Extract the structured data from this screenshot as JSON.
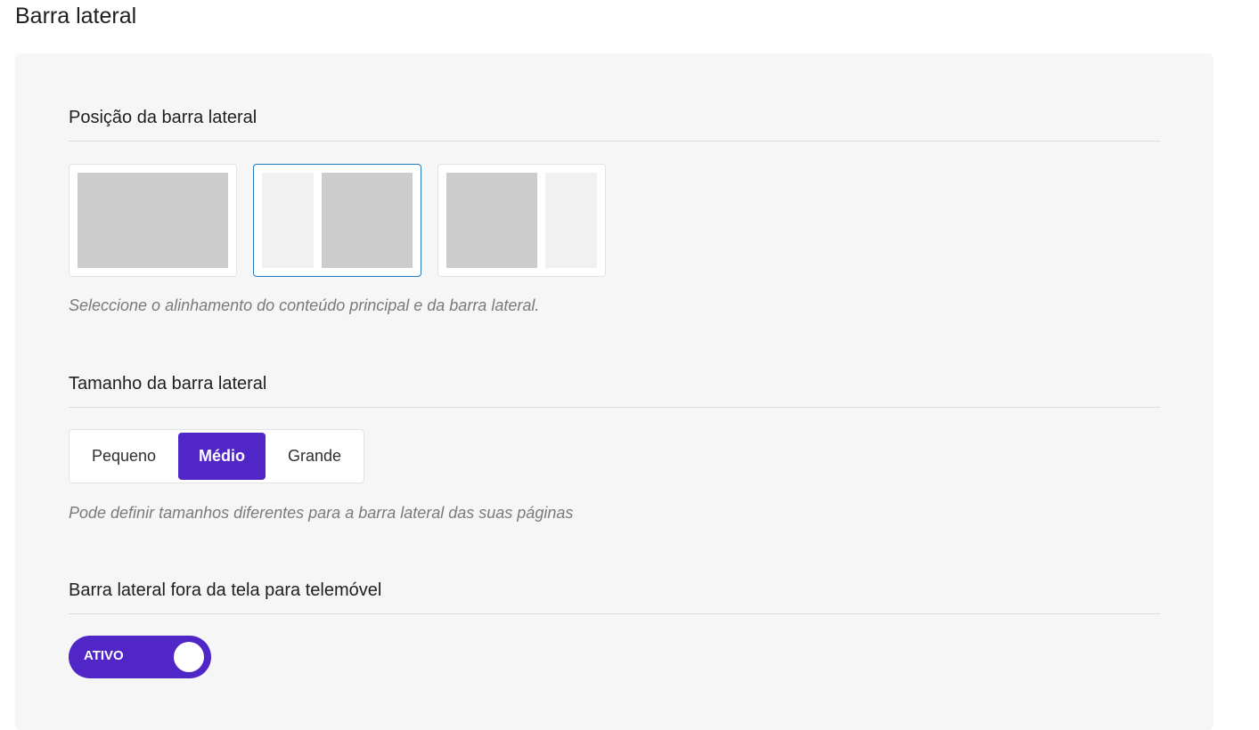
{
  "page": {
    "title": "Barra lateral"
  },
  "position": {
    "heading": "Posição da barra lateral",
    "help": "Seleccione o alinhamento do conteúdo principal e da barra lateral.",
    "options": [
      {
        "name": "full-width",
        "selected": false
      },
      {
        "name": "sidebar-left",
        "selected": true
      },
      {
        "name": "sidebar-right",
        "selected": false
      }
    ]
  },
  "size": {
    "heading": "Tamanho da barra lateral",
    "help": "Pode definir tamanhos diferentes para a barra lateral das suas páginas",
    "options": [
      "Pequeno",
      "Médio",
      "Grande"
    ],
    "selected": "Médio"
  },
  "offcanvas": {
    "heading": "Barra lateral fora da tela para telemóvel",
    "toggle_label": "ATIVO",
    "enabled": true
  },
  "colors": {
    "accent": "#5126c6",
    "selected_border": "#1f7bbd",
    "panel_bg": "#f6f6f6"
  }
}
